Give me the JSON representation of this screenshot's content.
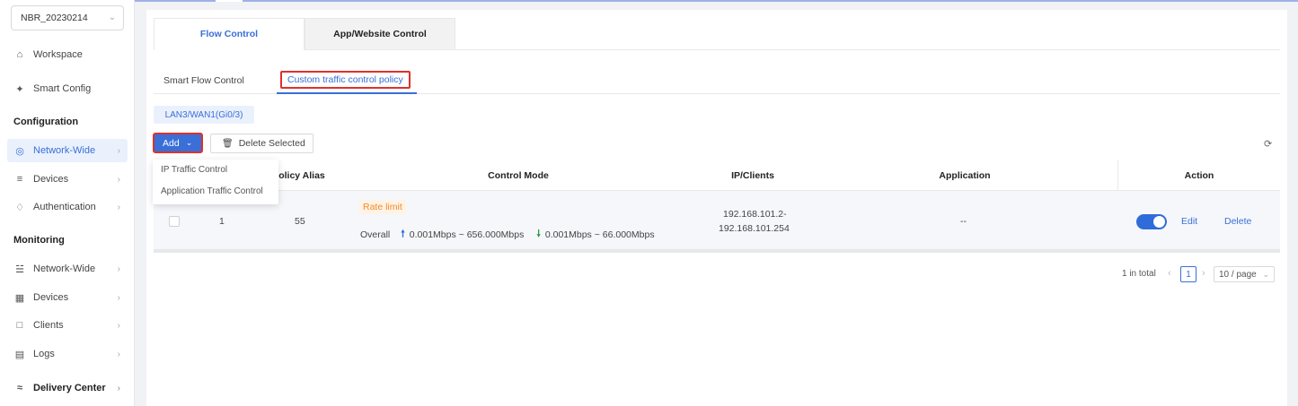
{
  "sidebar": {
    "device_name": "NBR_20230214",
    "items": [
      {
        "label": "Workspace",
        "icon": "home-icon"
      },
      {
        "label": "Smart Config",
        "icon": "wand-icon"
      }
    ],
    "groups": {
      "configuration": "Configuration",
      "monitoring": "Monitoring"
    },
    "config_items": [
      {
        "label": "Network-Wide",
        "icon": "globe-icon"
      },
      {
        "label": "Devices",
        "icon": "sliders-icon"
      },
      {
        "label": "Authentication",
        "icon": "shield-icon"
      }
    ],
    "monitor_items": [
      {
        "label": "Network-Wide",
        "icon": "topology-icon"
      },
      {
        "label": "Devices",
        "icon": "device-icon"
      },
      {
        "label": "Clients",
        "icon": "clients-icon"
      },
      {
        "label": "Logs",
        "icon": "logs-icon"
      }
    ],
    "delivery_center": "Delivery Center"
  },
  "tabs": {
    "primary": [
      "Flow Control",
      "App/Website Control"
    ],
    "secondary": [
      "Smart Flow Control",
      "Custom traffic control policy"
    ]
  },
  "interface_tag": "LAN3/WAN1(Gi0/3)",
  "toolbar": {
    "add_label": "Add",
    "delete_selected_label": "Delete Selected"
  },
  "add_menu": [
    "IP Traffic Control",
    "Application Traffic Control"
  ],
  "table": {
    "headers": {
      "policy_alias": "olicy Alias",
      "control_mode": "Control Mode",
      "ip_clients": "IP/Clients",
      "application": "Application",
      "action": "Action"
    },
    "rows": [
      {
        "index": "1",
        "alias": "55",
        "mode_badge": "Rate limit",
        "overall_label": "Overall",
        "up_rate": "0.001Mbps ~ 656.000Mbps",
        "down_rate": "0.001Mbps ~ 66.000Mbps",
        "ip_line1": "192.168.101.2-",
        "ip_line2": "192.168.101.254",
        "application": "--",
        "enabled": true,
        "edit_label": "Edit",
        "delete_label": "Delete"
      }
    ]
  },
  "pagination": {
    "total_text": "1 in total",
    "current_page": "1",
    "page_size": "10 / page"
  },
  "colors": {
    "accent": "#3a6fd8",
    "highlight_border": "#e0302b",
    "rate_badge": "#f08c2b",
    "up_arrow": "#2f6bd9",
    "down_arrow": "#2d9a3c"
  }
}
